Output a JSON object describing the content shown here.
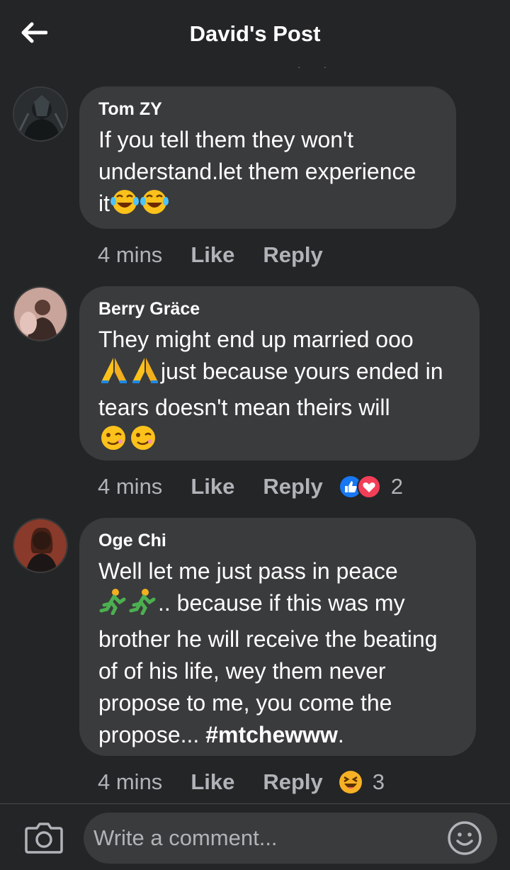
{
  "header": {
    "title": "David's Post",
    "dots": "· ·"
  },
  "comments": [
    {
      "author": "Tom ZY",
      "text_line1": "If you tell them they won't",
      "text_line2": "understand.let them experience",
      "text_line3": "it",
      "time": "4 mins",
      "like_label": "Like",
      "reply_label": "Reply"
    },
    {
      "author": "Berry Gräce",
      "text_line1": "They might end up married ooo",
      "text_line2": "just because yours ended in",
      "text_line3": "tears doesn't mean theirs will",
      "time": "4 mins",
      "like_label": "Like",
      "reply_label": "Reply",
      "reaction_count": "2"
    },
    {
      "author": "Oge Chi",
      "text_line1": "Well let me just pass in peace",
      "text_line2": ".. because if this was my",
      "text_line3": "brother he will receive the beating",
      "text_line4": "of of his life, wey them never",
      "text_line5": "propose to me, you come the",
      "text_line6": "propose... ",
      "hashtag": "#mtchewww",
      "text_end": ".",
      "time": "4 mins",
      "like_label": "Like",
      "reply_label": "Reply",
      "reaction_count": "3"
    }
  ],
  "composer": {
    "placeholder": "Write a comment..."
  },
  "colors": {
    "background": "#242526",
    "bubble": "#3a3b3c",
    "muted": "#b0b3b8",
    "like_blue": "#1877f2",
    "love_red": "#f33e58"
  },
  "icons": [
    "back-arrow-icon",
    "camera-icon",
    "smiley-icon",
    "like-reaction-icon",
    "love-reaction-icon",
    "haha-reaction-icon"
  ]
}
